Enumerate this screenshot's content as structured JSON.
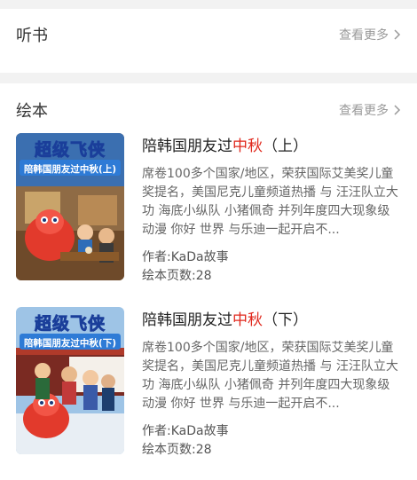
{
  "listen": {
    "title": "听书",
    "more": "查看更多"
  },
  "picture_books": {
    "title": "绘本",
    "more": "查看更多",
    "items": [
      {
        "title_before": "陪韩国朋友过",
        "title_highlight": "中秋",
        "title_after": "（上）",
        "description": "席卷100多个国家/地区，荣获国际艾美奖儿童奖提名，美国尼克儿童频道热播 与 汪汪队立大功 海底小纵队 小猪佩奇 并列年度四大现象级动漫 你好 世界 与乐迪一起开启不...",
        "author": "作者:KaDa故事",
        "pages": "绘本页数:28",
        "cover": {
          "logo": "超级飞侠",
          "subtitle": "陪韩国朋友过中秋(上)"
        }
      },
      {
        "title_before": "陪韩国朋友过",
        "title_highlight": "中秋",
        "title_after": "（下）",
        "description": "席卷100多个国家/地区，荣获国际艾美奖儿童奖提名，美国尼克儿童频道热播 与 汪汪队立大功 海底小纵队 小猪佩奇 并列年度四大现象级动漫 你好 世界 与乐迪一起开启不...",
        "author": "作者:KaDa故事",
        "pages": "绘本页数:28",
        "cover": {
          "logo": "超级飞侠",
          "subtitle": "陪韩国朋友过中秋(下)"
        }
      }
    ]
  },
  "colors": {
    "highlight": "#e0281c",
    "more_text": "#9a9a9a",
    "gap": "#f2f2f2"
  }
}
